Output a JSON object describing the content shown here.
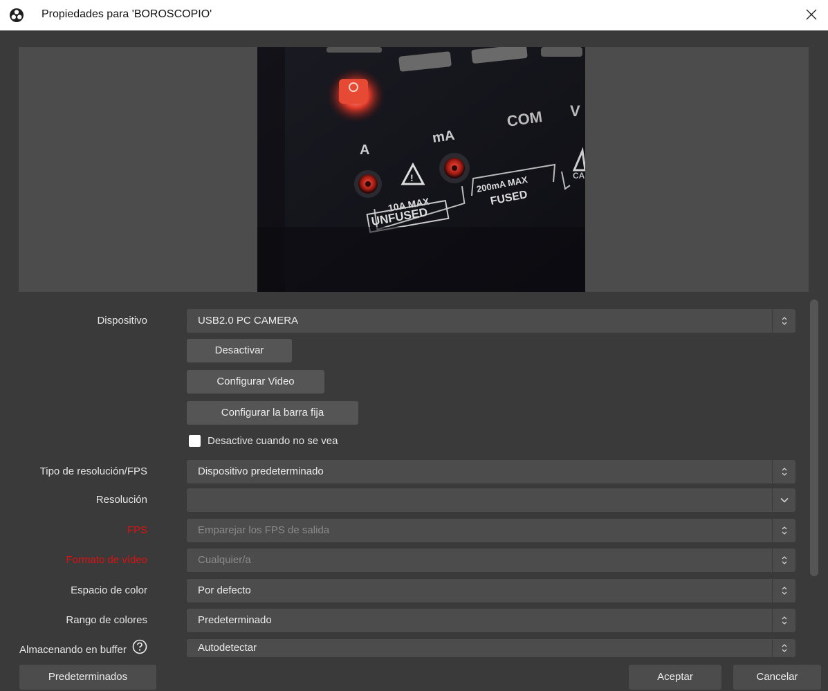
{
  "window": {
    "title": "Propiedades para 'BOROSCOPIO'",
    "app_icon": "obs-logo-icon",
    "close_icon": "close-icon"
  },
  "preview": {
    "camera_text": {
      "com": "COM",
      "a": "A",
      "ma": "mA",
      "ten_a_max": "10A MAX",
      "unfused": "UNFUSED",
      "two_hundred_ma_max": "200mA MAX",
      "fused": "FUSED"
    }
  },
  "form": {
    "device": {
      "label": "Dispositivo",
      "value": "USB2.0 PC CAMERA"
    },
    "buttons": {
      "deactivate": "Desactivar",
      "configure_video": "Configurar Video",
      "configure_crossbar": "Configurar la barra fija"
    },
    "checkbox": {
      "label": "Desactive cuando no se vea",
      "checked": false
    },
    "resolution_type": {
      "label": "Tipo de resolución/FPS",
      "value": "Dispositivo predeterminado"
    },
    "resolution": {
      "label": "Resolución",
      "value": ""
    },
    "fps": {
      "label": "FPS",
      "value": "Emparejar los FPS de salida"
    },
    "video_format": {
      "label": "Formato de vídeo",
      "value": "Cualquier/a"
    },
    "color_space": {
      "label": "Espacio de color",
      "value": "Por defecto"
    },
    "color_range": {
      "label": "Rango de colores",
      "value": "Predeterminado"
    },
    "buffering": {
      "label": "Almacenando en buffer",
      "value": "Autodetectar",
      "help_icon": "help-circle-icon"
    }
  },
  "footer": {
    "defaults": "Predeterminados",
    "accept": "Aceptar",
    "cancel": "Cancelar"
  },
  "colors": {
    "background": "#3a3a3a",
    "field": "#4c4c4c",
    "disabled_label": "#e01010"
  }
}
